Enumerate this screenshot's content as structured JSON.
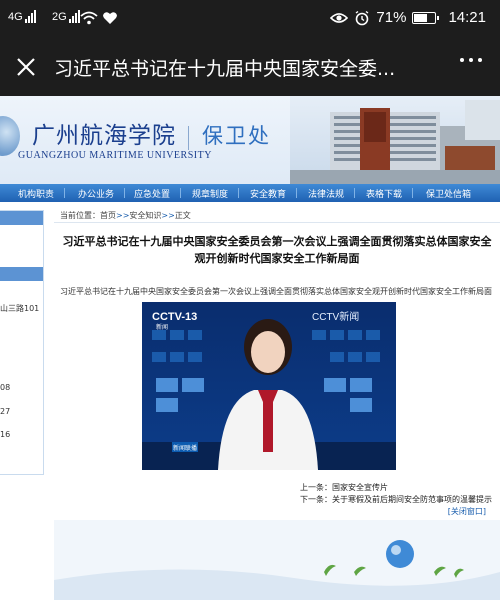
{
  "status": {
    "carrier1": "4G",
    "carrier2": "2G",
    "battery_percent": "71%",
    "battery_level": 0.71,
    "time": "14:21"
  },
  "titlebar": {
    "title": "习近平总书记在十九届中央国家安全委..."
  },
  "header": {
    "school_cn": "广州航海学院",
    "school_en": "GUANGZHOU MARITIME UNIVERSITY",
    "dept": "保卫处"
  },
  "nav": {
    "items": [
      "机构职责",
      "办公业务",
      "应急处置",
      "规章制度",
      "安全教育",
      "法律法规",
      "表格下载",
      "保卫处信箱"
    ]
  },
  "sidebar": {
    "lines": [
      "山三路101",
      "08",
      "27",
      "16"
    ]
  },
  "breadcrumb": {
    "prefix": "当前位置：",
    "home": "首页",
    "sep1": ">>",
    "section": "安全知识",
    "sep2": ">>",
    "current": "正文"
  },
  "article": {
    "title": "习近平总书记在十九届中央国家安全委员会第一次会议上强调全面贯彻落实总体国家安全观开创新时代国家安全工作新局面",
    "subtitle": "习近平总书记在十九届中央国家安全委员会第一次会议上强调全面贯彻落实总体国家安全观开创新时代国家安全工作新局面",
    "video_logo1": "CCTV-13",
    "video_logo1_sub": "新闻",
    "video_logo2": "CCTV新闻",
    "video_badge": "新闻联播"
  },
  "nav_links": {
    "prev_label": "上一条：",
    "prev": "国家安全宣传片",
    "next_label": "下一条：",
    "next": "关于寒假及前后期间安全防范事项的温馨提示",
    "close": "[关闭窗口]"
  },
  "colors": {
    "nav_blue": "#1f61b2",
    "brand_blue": "#1b3f8e",
    "dept_blue": "#2f6fbf"
  }
}
